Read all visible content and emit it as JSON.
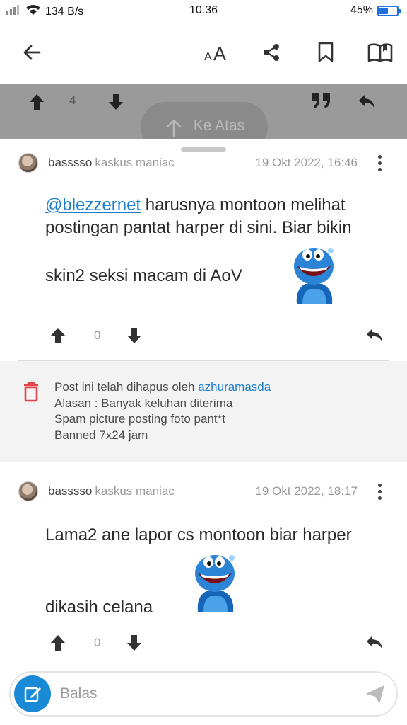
{
  "status_bar": {
    "signal_text": "⁺¹↑l",
    "speed": "134 B/s",
    "time": "10.36",
    "battery_percent": "45%",
    "battery_level": 0.45
  },
  "app_bar": {
    "font_size_label": "AA"
  },
  "previous_post_actions": {
    "vote_count": "4"
  },
  "scroll_top": {
    "label": "Ke Atas"
  },
  "posts": [
    {
      "username": "basssso",
      "rank": "kaskus maniac",
      "timestamp": "19 Okt 2022, 16:46",
      "mention": "@blezzernet",
      "text_line1": " harusnya montoon melihat",
      "text_line2": "postingan pantat harper di sini. Biar bikin",
      "text_line3": "skin2 seksi macam di AoV",
      "vote_count": "0"
    },
    {
      "username": "basssso",
      "rank": "kaskus maniac",
      "timestamp": "19 Okt 2022, 18:17",
      "text_line1": "Lama2 ane lapor cs montoon biar harper",
      "text_line2": "dikasih celana",
      "vote_count": "0"
    }
  ],
  "deleted_notice": {
    "prefix": "Post ini telah dihapus oleh ",
    "deleted_by": "azhuramasda",
    "reason": "Alasan : Banyak keluhan diterima",
    "detail": "Spam picture posting foto pant*t",
    "ban": "Banned 7x24 jam"
  },
  "reply_bar": {
    "placeholder": "Balas"
  },
  "colors": {
    "accent": "#1b8ad6",
    "delete_red": "#e0464a",
    "overlay": "#9a9a9a"
  }
}
